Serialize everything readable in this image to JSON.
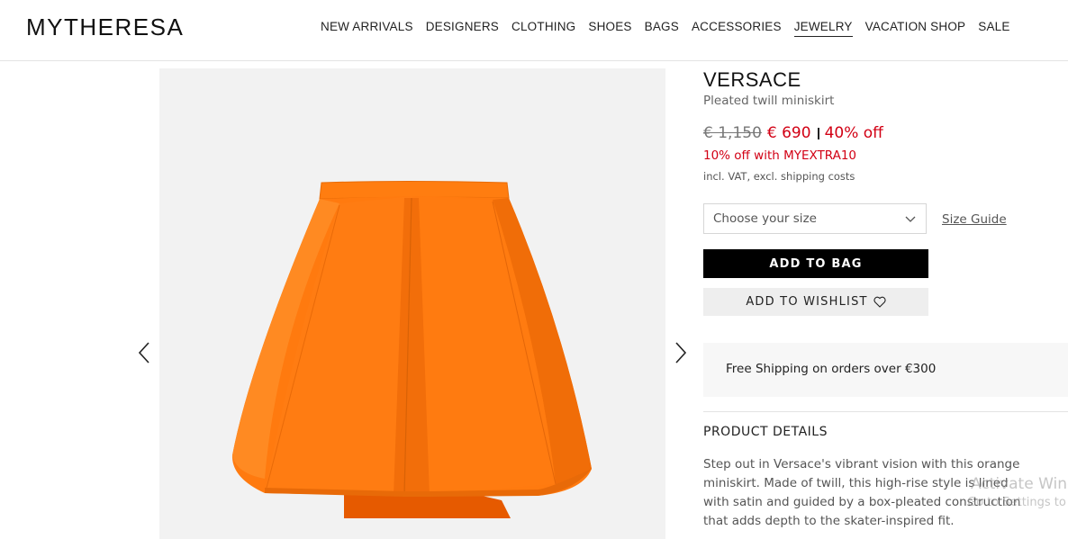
{
  "header": {
    "logo": "MYTHERESA",
    "nav": [
      "NEW ARRIVALS",
      "DESIGNERS",
      "CLOTHING",
      "SHOES",
      "BAGS",
      "ACCESSORIES",
      "JEWELRY",
      "VACATION SHOP",
      "SALE"
    ],
    "active_nav": "JEWELRY"
  },
  "product": {
    "brand": "VERSACE",
    "name": "Pleated twill miniskirt",
    "old_price": "€ 1,150",
    "new_price": "€ 690",
    "discount": "40% off",
    "promo": "10% off with MYEXTRA10",
    "vat_note": "incl. VAT, excl. shipping costs",
    "size_placeholder": "Choose your size",
    "size_guide": "Size Guide",
    "add_to_bag": "ADD TO BAG",
    "add_to_wishlist": "ADD TO WISHLIST",
    "shipping": "Free Shipping on orders over €300",
    "details_title": "PRODUCT DETAILS",
    "details_text": "Step out in Versace's vibrant vision with this orange miniskirt. Made of twill, this high-rise style is lined with satin and guided by a box-pleated construction that adds depth to the skater-inspired fit."
  },
  "overlay": {
    "line1": "Activate Windows",
    "line2": "Go to Settings to"
  },
  "colors": {
    "sale_red": "#d20014",
    "skirt_orange": "#ff7a0f",
    "gallery_bg": "#f2f2f2"
  },
  "icons": [
    "chevron-left-icon",
    "chevron-right-icon",
    "chevron-down-icon",
    "heart-icon"
  ]
}
